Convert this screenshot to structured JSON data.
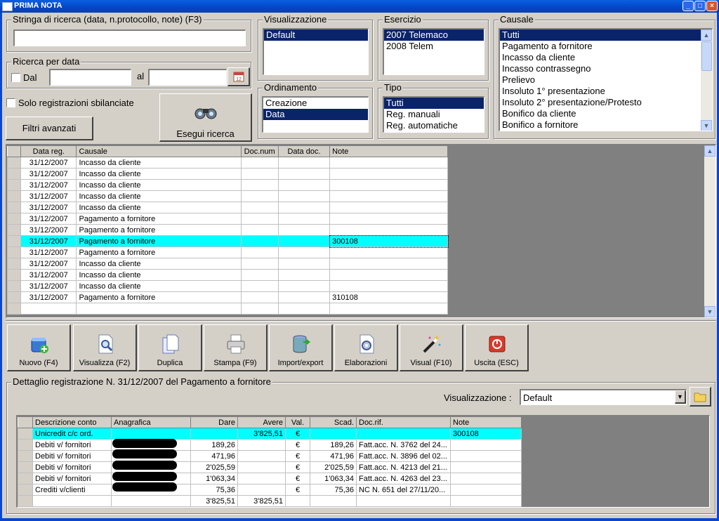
{
  "window": {
    "title": "PRIMA NOTA",
    "min": "_",
    "max": "□",
    "close": "×"
  },
  "search": {
    "label": "Stringa di ricerca (data, n.protocollo, note) (F3)",
    "value": ""
  },
  "date_search": {
    "label": "Ricerca per data",
    "dal_label": "Dal",
    "al_label": "al",
    "dal_value": "",
    "al_value": ""
  },
  "solo_sbilanciate": "Solo registrazioni sbilanciate",
  "filtri_avanzati": "Filtri avanzati",
  "esegui_ricerca": "Esegui ricerca",
  "visualizzazione": {
    "label": "Visualizzazione",
    "items": [
      "Default"
    ],
    "selected": 0
  },
  "esercizio": {
    "label": "Esercizio",
    "items": [
      "2007 Telemaco",
      "2008 Telem"
    ],
    "selected": 0
  },
  "causale": {
    "label": "Causale",
    "items": [
      "Tutti",
      "Pagamento a fornitore",
      "Incasso da cliente",
      "Incasso contrassegno",
      "Prelievo",
      "Insoluto 1° presentazione",
      "Insoluto 2° presentazione/Protesto",
      "Bonifico da cliente",
      "Bonifico a fornitore"
    ],
    "selected": 0
  },
  "ordinamento": {
    "label": "Ordinamento",
    "items": [
      "Creazione",
      "Data"
    ],
    "selected": 1
  },
  "tipo": {
    "label": "Tipo",
    "items": [
      "Tutti",
      "Reg. manuali",
      "Reg. automatiche"
    ],
    "selected": 0
  },
  "main_grid": {
    "headers": [
      "Data reg.",
      "Causale",
      "Doc.num",
      "Data doc.",
      "Note"
    ],
    "rows": [
      [
        "31/12/2007",
        "Incasso da cliente",
        "",
        "",
        ""
      ],
      [
        "31/12/2007",
        "Incasso da cliente",
        "",
        "",
        ""
      ],
      [
        "31/12/2007",
        "Incasso da cliente",
        "",
        "",
        ""
      ],
      [
        "31/12/2007",
        "Incasso da cliente",
        "",
        "",
        ""
      ],
      [
        "31/12/2007",
        "Incasso da cliente",
        "",
        "",
        ""
      ],
      [
        "31/12/2007",
        "Pagamento a fornitore",
        "",
        "",
        ""
      ],
      [
        "31/12/2007",
        "Pagamento a fornitore",
        "",
        "",
        ""
      ],
      [
        "31/12/2007",
        "Pagamento a fornitore",
        "",
        "",
        "300108"
      ],
      [
        "31/12/2007",
        "Pagamento a fornitore",
        "",
        "",
        ""
      ],
      [
        "31/12/2007",
        "Incasso da cliente",
        "",
        "",
        ""
      ],
      [
        "31/12/2007",
        "Incasso da cliente",
        "",
        "",
        ""
      ],
      [
        "31/12/2007",
        "Incasso da cliente",
        "",
        "",
        ""
      ],
      [
        "31/12/2007",
        "Pagamento a fornitore",
        "",
        "",
        "310108"
      ],
      [
        "",
        "",
        "",
        "",
        ""
      ]
    ],
    "highlight_row": 7
  },
  "toolbar": [
    {
      "label": "Nuovo (F4)",
      "icon": "new-record-icon"
    },
    {
      "label": "Visualizza (F2)",
      "icon": "view-document-icon"
    },
    {
      "label": "Duplica",
      "icon": "duplicate-icon"
    },
    {
      "label": "Stampa (F9)",
      "icon": "printer-icon"
    },
    {
      "label": "Import/export",
      "icon": "database-import-icon"
    },
    {
      "label": "Elaborazioni",
      "icon": "process-gear-icon"
    },
    {
      "label": "Visual (F10)",
      "icon": "magic-wand-icon"
    },
    {
      "label": "Uscita (ESC)",
      "icon": "exit-power-icon"
    }
  ],
  "detail": {
    "label": "Dettaglio registrazione N. 31/12/2007 del Pagamento a fornitore",
    "vis_label": "Visualizzazione :",
    "vis_value": "Default",
    "headers": [
      "Descrizione conto",
      "Anagrafica",
      "Dare",
      "Avere",
      "Val.",
      "Scad.",
      "Doc.rif.",
      "Note"
    ],
    "rows": [
      [
        "Unicredit c/c ord.",
        "",
        "",
        "3'825,51",
        "€",
        "",
        "",
        "300108"
      ],
      [
        "Debiti v/ fornitori",
        "",
        "189,26",
        "",
        "€",
        "189,26",
        "Fatt.acc. N. 3762 del 24...",
        ""
      ],
      [
        "Debiti v/ fornitori",
        "",
        "471,96",
        "",
        "€",
        "471,96",
        "Fatt.acc. N. 3896 del 02...",
        ""
      ],
      [
        "Debiti v/ fornitori",
        "",
        "2'025,59",
        "",
        "€",
        "2'025,59",
        "Fatt.acc. N. 4213 del 21...",
        ""
      ],
      [
        "Debiti v/ fornitori",
        "",
        "1'063,34",
        "",
        "€",
        "1'063,34",
        "Fatt.acc. N. 4263 del 23...",
        ""
      ],
      [
        "Crediti v/clienti",
        "",
        "75,36",
        "",
        "€",
        "75,36",
        "NC N. 651 del 27/11/20...",
        ""
      ],
      [
        "",
        "",
        "3'825,51",
        "3'825,51",
        "",
        "",
        "",
        ""
      ]
    ],
    "highlight_row": 0
  }
}
